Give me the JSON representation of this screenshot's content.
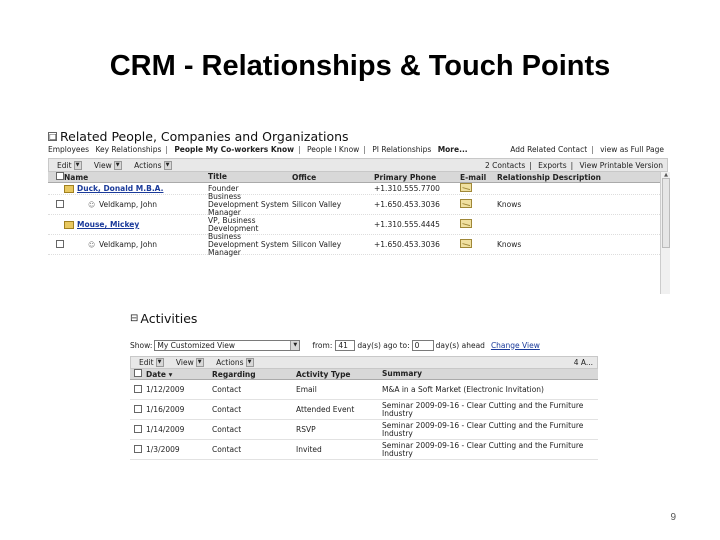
{
  "slide": {
    "title": "CRM - Relationships & Touch Points",
    "page_number": "9"
  },
  "related": {
    "collapse_symbol": "□",
    "title": "Related People, Companies and Organizations",
    "tabs": [
      "Employees",
      "Key Relationships",
      "People My Co-workers Know",
      "People I Know",
      "PI Relationships",
      "More..."
    ],
    "right_links": [
      "Add Related Contact",
      "view as Full Page"
    ],
    "toolbar": {
      "edit_label": "Edit",
      "view_label": "View",
      "actions_label": "Actions",
      "contacts_count": "2 Contacts",
      "exports_label": "Exports",
      "printable_label": "View Printable Version"
    },
    "columns": [
      "Name",
      "Title",
      "Office",
      "Primary Phone",
      "E-mail",
      "Relationship Description"
    ],
    "rows": [
      {
        "name": "Duck, Donald M.B.A.",
        "title": "Founder",
        "office": "",
        "phone": "+1.310.555.7700",
        "description": "",
        "kind": "contact"
      },
      {
        "name": "Veldkamp, John",
        "title": "Business Development System Manager",
        "office": "Silicon Valley",
        "phone": "+1.650.453.3036",
        "description": "Knows",
        "kind": "person"
      },
      {
        "name": "Mouse, Mickey",
        "title": "VP, Business Development",
        "office": "",
        "phone": "+1.310.555.4445",
        "description": "",
        "kind": "contact"
      },
      {
        "name": "Veldkamp, John",
        "title": "Business Development System Manager",
        "office": "Silicon Valley",
        "phone": "+1.650.453.3036",
        "description": "Knows",
        "kind": "person"
      }
    ]
  },
  "activities": {
    "collapse_symbol": "⊟",
    "title": "Activities",
    "filter": {
      "show_label": "Show:",
      "view_value": "My Customized View",
      "from_label": "from:",
      "from_value": "41",
      "days_ago_label": "day(s) ago to:",
      "to_value": "0",
      "days_ahead_label": "day(s) ahead",
      "change_view_label": "Change View"
    },
    "toolbar": {
      "edit_label": "Edit",
      "view_label": "View",
      "actions_label": "Actions",
      "count": "4 A..."
    },
    "columns": [
      "Date",
      "Regarding",
      "Activity Type",
      "Summary"
    ],
    "rows": [
      {
        "date": "1/12/2009",
        "regarding": "Contact",
        "type": "Email",
        "summary": "M&A in a Soft Market (Electronic Invitation)"
      },
      {
        "date": "1/16/2009",
        "regarding": "Contact",
        "type": "Attended Event",
        "summary": "Seminar 2009-09-16 - Clear Cutting and the Furniture Industry"
      },
      {
        "date": "1/14/2009",
        "regarding": "Contact",
        "type": "RSVP",
        "summary": "Seminar 2009-09-16 - Clear Cutting and the Furniture Industry"
      },
      {
        "date": "1/3/2009",
        "regarding": "Contact",
        "type": "Invited",
        "summary": "Seminar 2009-09-16 - Clear Cutting and the Furniture Industry"
      }
    ]
  },
  "icons": {
    "contact": "contact-card-icon",
    "person": "person-icon",
    "email": "email-envelope-icon"
  },
  "colors": {
    "link": "#1a3a9a",
    "header_bg": "#d8d8d8",
    "toolbar_bg": "#e8e8e8"
  }
}
